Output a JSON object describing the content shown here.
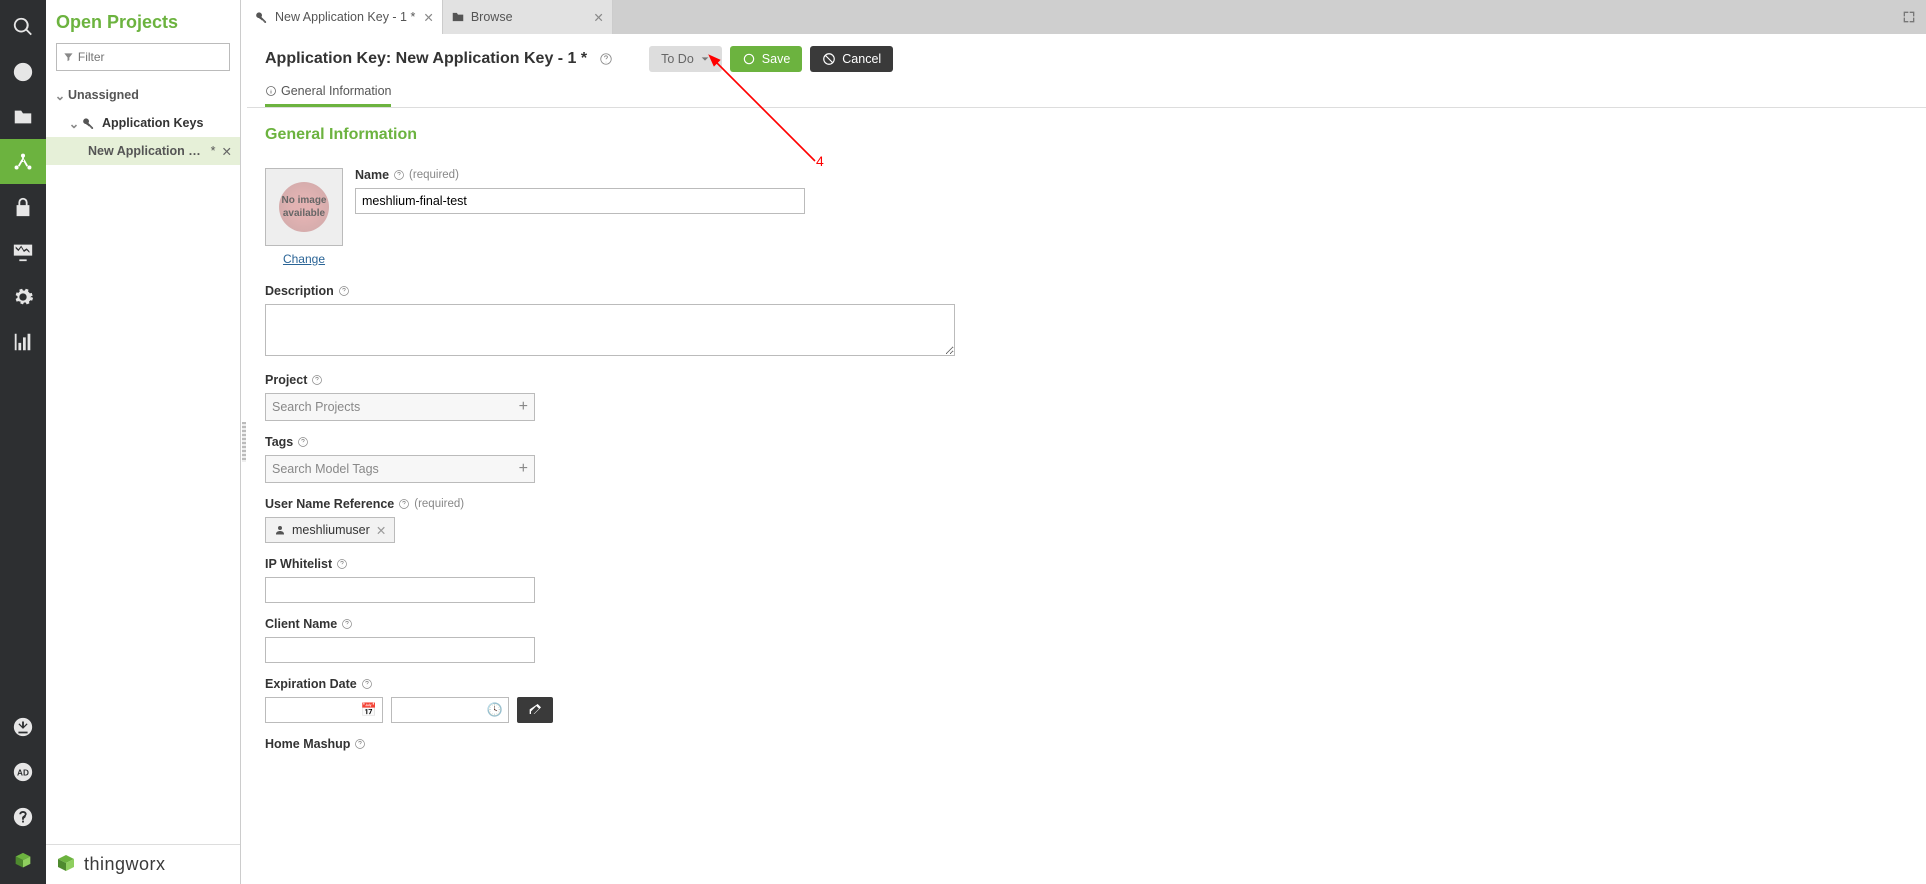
{
  "sidebar": {
    "title": "Open Projects",
    "filter_placeholder": "Filter",
    "tree": {
      "unassigned": "Unassigned",
      "app_keys": "Application Keys",
      "item": "New Application Ke…",
      "item_dirty": "*"
    },
    "footer_brand": "thingworx"
  },
  "tabs": {
    "t1": "New Application Key - 1 *",
    "t2": "Browse"
  },
  "header": {
    "title": "Application Key: New Application Key - 1 *",
    "todo": "To Do",
    "save": "Save",
    "cancel": "Cancel"
  },
  "subtabs": {
    "general": "General Information"
  },
  "section": {
    "title": "General Information"
  },
  "thumb": {
    "noimg": "No image available",
    "change": "Change"
  },
  "fields": {
    "name_label": "Name",
    "required": "(required)",
    "name_value": "meshlium-final-test",
    "description_label": "Description",
    "description_value": "",
    "project_label": "Project",
    "project_placeholder": "Search Projects",
    "tags_label": "Tags",
    "tags_placeholder": "Search Model Tags",
    "userref_label": "User Name Reference",
    "userref_value": "meshliumuser",
    "ipwhitelist_label": "IP Whitelist",
    "clientname_label": "Client Name",
    "expiration_label": "Expiration Date",
    "homemashup_label": "Home Mashup"
  },
  "annotation": {
    "num": "4"
  }
}
